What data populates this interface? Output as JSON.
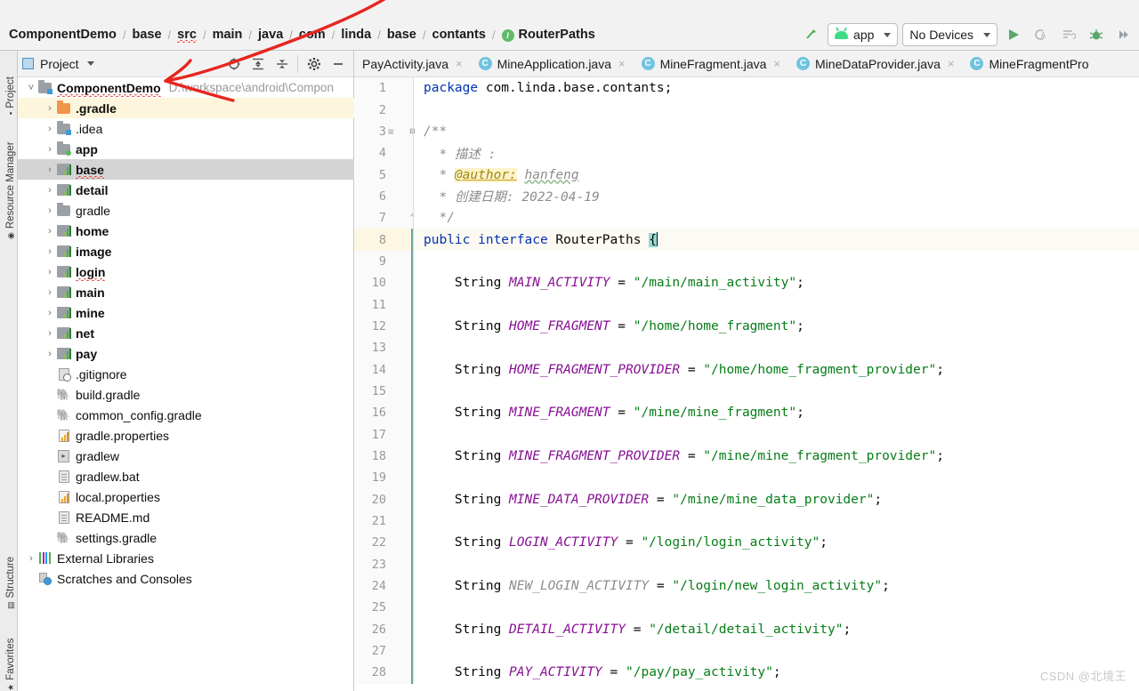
{
  "window": {
    "ide": "Android Studio"
  },
  "breadcrumb": {
    "items": [
      {
        "label": "ComponentDemo",
        "icon": "none"
      },
      {
        "label": "base",
        "icon": "none"
      },
      {
        "label": "src",
        "icon": "none"
      },
      {
        "label": "main",
        "icon": "none"
      },
      {
        "label": "java",
        "icon": "none"
      },
      {
        "label": "com",
        "icon": "none"
      },
      {
        "label": "linda",
        "icon": "none"
      },
      {
        "label": "base",
        "icon": "none"
      },
      {
        "label": "contants",
        "icon": "none"
      },
      {
        "label": "RouterPaths",
        "icon": "interface-icon"
      }
    ],
    "separator": "/"
  },
  "toolbar": {
    "run_config": "app",
    "device": "No Devices",
    "icons": [
      "sync-gradle-icon",
      "run-icon",
      "debug-attach-icon",
      "profiler-icon",
      "debug-icon",
      "apply-changes-icon"
    ]
  },
  "left_rail": {
    "items": [
      {
        "label": "Project",
        "icon": "project-icon"
      },
      {
        "label": "Resource Manager",
        "icon": "resource-manager-icon"
      },
      {
        "label": "Structure",
        "icon": "structure-icon"
      },
      {
        "label": "Favorites",
        "icon": "favorites-icon"
      }
    ]
  },
  "project_panel": {
    "title": "Project",
    "title_caret": "▾",
    "icons": [
      "locate-icon",
      "expand-all-icon",
      "collapse-all-icon",
      "settings-gear-icon",
      "hide-icon"
    ],
    "tree": [
      {
        "label": "ComponentDemo",
        "sub": "D:\\workspace\\android\\Compon",
        "arrow": "˅",
        "icon": "module-root-icon",
        "indent": 0,
        "bold": true,
        "state": "none",
        "squiggle": true
      },
      {
        "label": ".gradle",
        "sub": "",
        "arrow": "›",
        "icon": "folder-orange-icon",
        "indent": 1,
        "bold": true,
        "state": "highlight",
        "squiggle": false
      },
      {
        "label": ".idea",
        "sub": "",
        "arrow": "›",
        "icon": "folder-module-icon",
        "indent": 1,
        "bold": false,
        "state": "none",
        "squiggle": false
      },
      {
        "label": "app",
        "sub": "",
        "arrow": "›",
        "icon": "folder-source-icon",
        "indent": 1,
        "bold": true,
        "state": "none",
        "squiggle": false
      },
      {
        "label": "base",
        "sub": "",
        "arrow": "›",
        "icon": "module-icon",
        "indent": 1,
        "bold": true,
        "state": "selected",
        "squiggle": true
      },
      {
        "label": "detail",
        "sub": "",
        "arrow": "›",
        "icon": "module-icon",
        "indent": 1,
        "bold": true,
        "state": "none",
        "squiggle": false
      },
      {
        "label": "gradle",
        "sub": "",
        "arrow": "›",
        "icon": "folder-plain-icon",
        "indent": 1,
        "bold": false,
        "state": "none",
        "squiggle": false
      },
      {
        "label": "home",
        "sub": "",
        "arrow": "›",
        "icon": "module-icon",
        "indent": 1,
        "bold": true,
        "state": "none",
        "squiggle": false
      },
      {
        "label": "image",
        "sub": "",
        "arrow": "›",
        "icon": "module-icon",
        "indent": 1,
        "bold": true,
        "state": "none",
        "squiggle": false
      },
      {
        "label": "login",
        "sub": "",
        "arrow": "›",
        "icon": "module-icon",
        "indent": 1,
        "bold": true,
        "state": "none",
        "squiggle": true
      },
      {
        "label": "main",
        "sub": "",
        "arrow": "›",
        "icon": "module-icon",
        "indent": 1,
        "bold": true,
        "state": "none",
        "squiggle": false
      },
      {
        "label": "mine",
        "sub": "",
        "arrow": "›",
        "icon": "module-icon",
        "indent": 1,
        "bold": true,
        "state": "none",
        "squiggle": false
      },
      {
        "label": "net",
        "sub": "",
        "arrow": "›",
        "icon": "module-icon",
        "indent": 1,
        "bold": true,
        "state": "none",
        "squiggle": false
      },
      {
        "label": "pay",
        "sub": "",
        "arrow": "›",
        "icon": "module-icon",
        "indent": 1,
        "bold": true,
        "state": "none",
        "squiggle": false
      },
      {
        "label": ".gitignore",
        "sub": "",
        "arrow": "",
        "icon": "gitignore-icon",
        "indent": 1,
        "bold": false,
        "state": "none",
        "squiggle": false
      },
      {
        "label": "build.gradle",
        "sub": "",
        "arrow": "",
        "icon": "gradle-icon",
        "indent": 1,
        "bold": false,
        "state": "none",
        "squiggle": false
      },
      {
        "label": "common_config.gradle",
        "sub": "",
        "arrow": "",
        "icon": "gradle-icon",
        "indent": 1,
        "bold": false,
        "state": "none",
        "squiggle": false
      },
      {
        "label": "gradle.properties",
        "sub": "",
        "arrow": "",
        "icon": "properties-icon",
        "indent": 1,
        "bold": false,
        "state": "none",
        "squiggle": false
      },
      {
        "label": "gradlew",
        "sub": "",
        "arrow": "",
        "icon": "shell-script-icon",
        "indent": 1,
        "bold": false,
        "state": "none",
        "squiggle": false
      },
      {
        "label": "gradlew.bat",
        "sub": "",
        "arrow": "",
        "icon": "text-file-icon",
        "indent": 1,
        "bold": false,
        "state": "none",
        "squiggle": false
      },
      {
        "label": "local.properties",
        "sub": "",
        "arrow": "",
        "icon": "properties-icon",
        "indent": 1,
        "bold": false,
        "state": "none",
        "squiggle": false
      },
      {
        "label": "README.md",
        "sub": "",
        "arrow": "",
        "icon": "text-file-icon",
        "indent": 1,
        "bold": false,
        "state": "none",
        "squiggle": false
      },
      {
        "label": "settings.gradle",
        "sub": "",
        "arrow": "",
        "icon": "gradle-icon",
        "indent": 1,
        "bold": false,
        "state": "none",
        "squiggle": false
      },
      {
        "label": "External Libraries",
        "sub": "",
        "arrow": "›",
        "icon": "external-libraries-icon",
        "indent": 0,
        "bold": false,
        "state": "none",
        "squiggle": false
      },
      {
        "label": "Scratches and Consoles",
        "sub": "",
        "arrow": "",
        "icon": "scratches-icon",
        "indent": 0,
        "bold": false,
        "state": "none",
        "squiggle": false
      }
    ]
  },
  "editor": {
    "tabs": [
      {
        "label": "PayActivity.java",
        "icon": "none",
        "active": false
      },
      {
        "label": "MineApplication.java",
        "icon": "java-class-icon",
        "active": false
      },
      {
        "label": "MineFragment.java",
        "icon": "java-class-icon",
        "active": false
      },
      {
        "label": "MineDataProvider.java",
        "icon": "java-class-icon",
        "active": false
      },
      {
        "label": "MineFragmentPro",
        "icon": "java-class-icon",
        "active": false
      }
    ],
    "close_glyph": "×",
    "current_line": 8,
    "lines": [
      {
        "n": 1,
        "html": "<span class=\"kw\">package</span> com.linda.base.contants;"
      },
      {
        "n": 2,
        "html": ""
      },
      {
        "n": 3,
        "html": "<span class=\"cm\">/**</span>",
        "gicon": "javadoc-render-icon",
        "fold": "minus"
      },
      {
        "n": 4,
        "html": "  <span class=\"cm\">* 描述 :</span>"
      },
      {
        "n": 5,
        "html": "  <span class=\"cm\">* </span><span class=\"tag\">@author:</span><span class=\"cm\"> </span><span class=\"cm sqg\">hanfeng</span>"
      },
      {
        "n": 6,
        "html": "  <span class=\"cm\">* 创建日期: 2022-04-19</span>"
      },
      {
        "n": 7,
        "html": "  <span class=\"cm\">*/</span>",
        "fold": "end"
      },
      {
        "n": 8,
        "html": "<span class=\"kw\">public interface</span> RouterPaths <span class=\"brace-hl\">{</span><span class=\"caretbar\"></span>",
        "cur": true,
        "chg": true
      },
      {
        "n": 9,
        "html": "",
        "chg": true
      },
      {
        "n": 10,
        "html": "    String <span class=\"cst\">MAIN_ACTIVITY</span> = <span class=\"str\">\"/main/main_activity\"</span>;",
        "chg": true
      },
      {
        "n": 11,
        "html": "",
        "chg": true
      },
      {
        "n": 12,
        "html": "    String <span class=\"cst\">HOME_FRAGMENT</span> = <span class=\"str\">\"/home/home_fragment\"</span>;",
        "chg": true
      },
      {
        "n": 13,
        "html": "",
        "chg": true
      },
      {
        "n": 14,
        "html": "    String <span class=\"cst\">HOME_FRAGMENT_PROVIDER</span> = <span class=\"str\">\"/home/home_fragment_provider\"</span>;",
        "chg": true
      },
      {
        "n": 15,
        "html": "",
        "chg": true
      },
      {
        "n": 16,
        "html": "    String <span class=\"cst\">MINE_FRAGMENT</span> = <span class=\"str\">\"/mine/mine_fragment\"</span>;",
        "chg": true
      },
      {
        "n": 17,
        "html": "",
        "chg": true
      },
      {
        "n": 18,
        "html": "    String <span class=\"cst\">MINE_FRAGMENT_PROVIDER</span> = <span class=\"str\">\"/mine/mine_fragment_provider\"</span>;",
        "chg": true
      },
      {
        "n": 19,
        "html": "",
        "chg": true
      },
      {
        "n": 20,
        "html": "    String <span class=\"cst\">MINE_DATA_PROVIDER</span> = <span class=\"str\">\"/mine/mine_data_provider\"</span>;",
        "chg": true
      },
      {
        "n": 21,
        "html": "",
        "chg": true
      },
      {
        "n": 22,
        "html": "    String <span class=\"cst\">LOGIN_ACTIVITY</span> = <span class=\"str\">\"/login/login_activity\"</span>;",
        "chg": true
      },
      {
        "n": 23,
        "html": "",
        "chg": true
      },
      {
        "n": 24,
        "html": "    String <span class=\"cst unused\">NEW_LOGIN_ACTIVITY</span> = <span class=\"str\">\"/login/new_login_activity\"</span>;",
        "chg": true
      },
      {
        "n": 25,
        "html": "",
        "chg": true
      },
      {
        "n": 26,
        "html": "    String <span class=\"cst\">DETAIL_ACTIVITY</span> = <span class=\"str\">\"/detail/detail_activity\"</span>;",
        "chg": true
      },
      {
        "n": 27,
        "html": "",
        "chg": true
      },
      {
        "n": 28,
        "html": "    String <span class=\"cst\">PAY_ACTIVITY</span> = <span class=\"str\">\"/pay/pay_activity\"</span>;",
        "chg": true
      }
    ]
  },
  "watermark": {
    "text": "CSDN @北境王"
  },
  "annotation": {
    "type": "hand-drawn-arrow",
    "color": "#e8251f"
  },
  "colors": {
    "keyword": "#0033B3",
    "string": "#067D17",
    "constant": "#871094",
    "comment": "#8C8C8C",
    "selection": "#D4D4D4",
    "current_line": "#FCFAF2",
    "accent_green": "#3DDC84"
  }
}
